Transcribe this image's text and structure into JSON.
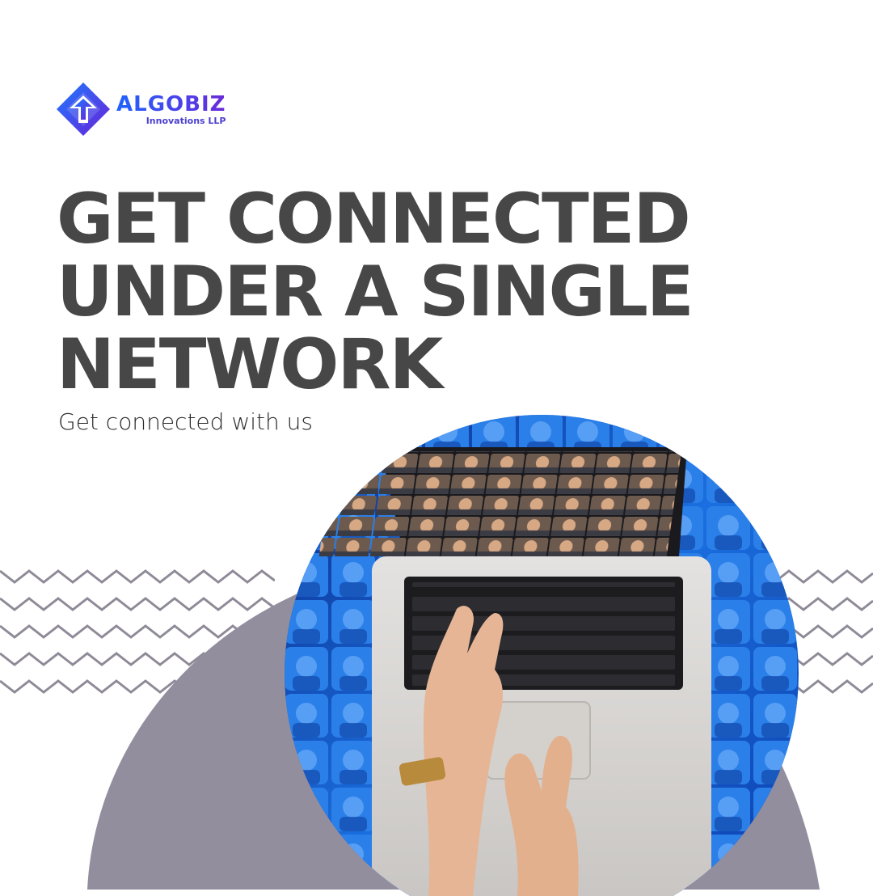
{
  "brand": {
    "name": "ALGOBIZ",
    "tagline": "Innovations LLP",
    "logo_icon": "diamond-arrow-logo-icon"
  },
  "headline": {
    "line1": "GET CONNECTED",
    "line2": "UNDER A SINGLE",
    "line3": "NETWORK"
  },
  "subtitle": "Get connected with us",
  "colors": {
    "headline": "#474747",
    "blob": "#938e9e",
    "zigzag": "#8f8a97",
    "brand_blue": "#1e63ff",
    "brand_purple": "#6a2bd9"
  },
  "image": {
    "subject": "hands typing on laptop with video-call grid of faces, circular frame over blue portrait mosaic"
  }
}
